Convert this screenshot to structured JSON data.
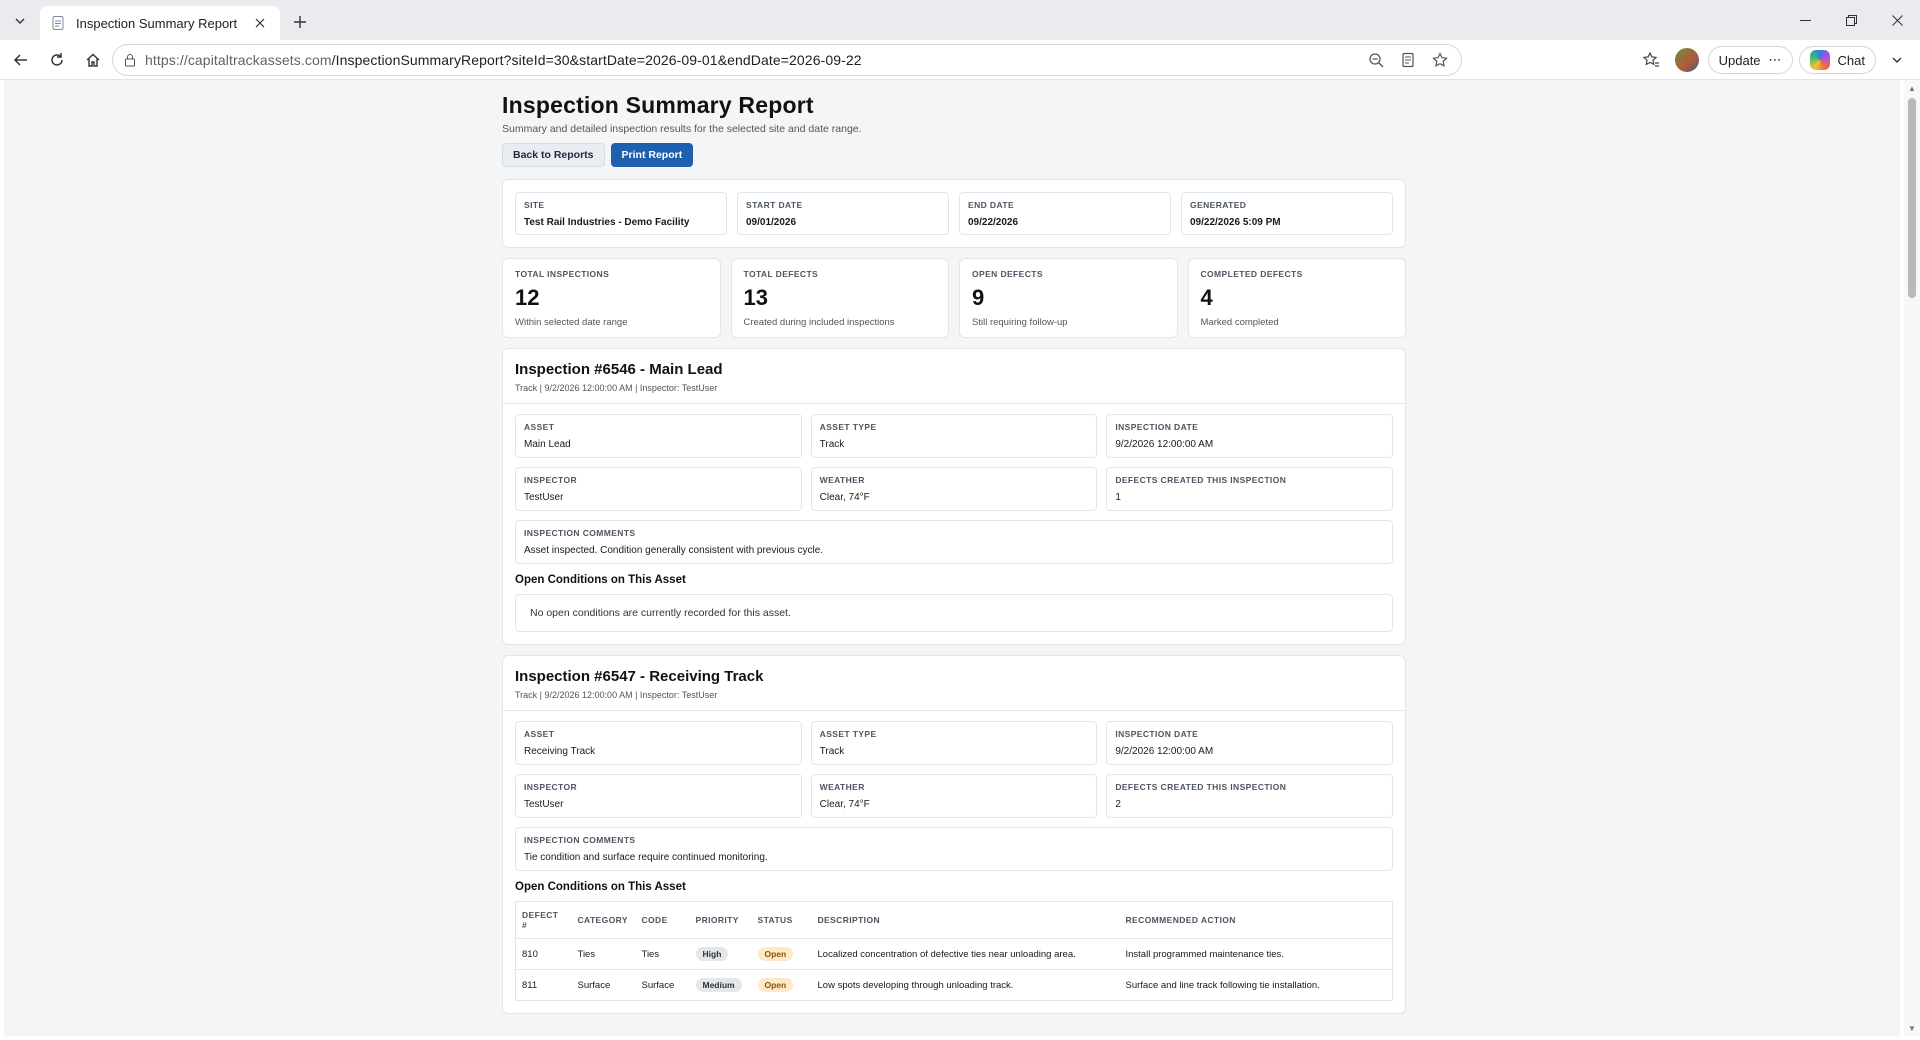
{
  "browser": {
    "tab_title": "Inspection Summary Report",
    "url_host": "https://capitaltrackassets.com",
    "url_path": "/InspectionSummaryReport?siteId=30&startDate=2026-09-01&endDate=2026-09-22",
    "update_label": "Update",
    "chat_label": "Chat"
  },
  "report": {
    "title": "Inspection Summary Report",
    "subtitle": "Summary and detailed inspection results for the selected site and date range.",
    "back_label": "Back to Reports",
    "print_label": "Print Report",
    "meta": [
      {
        "label": "SITE",
        "value": "Test Rail Industries - Demo Facility"
      },
      {
        "label": "START DATE",
        "value": "09/01/2026"
      },
      {
        "label": "END DATE",
        "value": "09/22/2026"
      },
      {
        "label": "GENERATED",
        "value": "09/22/2026 5:09 PM"
      }
    ],
    "stats": [
      {
        "label": "TOTAL INSPECTIONS",
        "value": "12",
        "note": "Within selected date range"
      },
      {
        "label": "TOTAL DEFECTS",
        "value": "13",
        "note": "Created during included inspections"
      },
      {
        "label": "OPEN DEFECTS",
        "value": "9",
        "note": "Still requiring follow-up"
      },
      {
        "label": "COMPLETED DEFECTS",
        "value": "4",
        "note": "Marked completed"
      }
    ]
  },
  "inspections": [
    {
      "title": "Inspection #6546 - Main Lead",
      "sub": "Track | 9/2/2026 12:00:00 AM | Inspector: TestUser",
      "asset_label": "ASSET",
      "asset": "Main Lead",
      "type_label": "ASSET TYPE",
      "type": "Track",
      "date_label": "INSPECTION DATE",
      "date": "9/2/2026 12:00:00 AM",
      "inspector_label": "INSPECTOR",
      "inspector": "TestUser",
      "weather_label": "WEATHER",
      "weather": "Clear, 74°F",
      "defects_label": "DEFECTS CREATED THIS INSPECTION",
      "defects": "1",
      "comments_label": "INSPECTION COMMENTS",
      "comments": "Asset inspected. Condition generally consistent with previous cycle.",
      "conditions_title": "Open Conditions on This Asset",
      "empty_text": "No open conditions are currently recorded for this asset."
    },
    {
      "title": "Inspection #6547 - Receiving Track",
      "sub": "Track | 9/2/2026 12:00:00 AM | Inspector: TestUser",
      "asset_label": "ASSET",
      "asset": "Receiving Track",
      "type_label": "ASSET TYPE",
      "type": "Track",
      "date_label": "INSPECTION DATE",
      "date": "9/2/2026 12:00:00 AM",
      "inspector_label": "INSPECTOR",
      "inspector": "TestUser",
      "weather_label": "WEATHER",
      "weather": "Clear, 74°F",
      "defects_label": "DEFECTS CREATED THIS INSPECTION",
      "defects": "2",
      "comments_label": "INSPECTION COMMENTS",
      "comments": "Tie condition and surface require continued monitoring.",
      "conditions_title": "Open Conditions on This Asset",
      "table": {
        "headers": [
          "DEFECT #",
          "CATEGORY",
          "CODE",
          "PRIORITY",
          "STATUS",
          "DESCRIPTION",
          "RECOMMENDED ACTION"
        ],
        "rows": [
          {
            "id": "810",
            "category": "Ties",
            "code": "Ties",
            "priority": "High",
            "status": "Open",
            "description": "Localized concentration of defective ties near unloading area.",
            "action": "Install programmed maintenance ties."
          },
          {
            "id": "811",
            "category": "Surface",
            "code": "Surface",
            "priority": "Medium",
            "status": "Open",
            "description": "Low spots developing through unloading track.",
            "action": "Surface and line track following tie installation."
          }
        ]
      }
    }
  ]
}
